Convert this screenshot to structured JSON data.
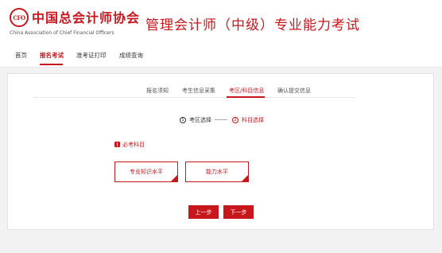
{
  "header": {
    "logo_emblem": "CFO",
    "logo_cn": "中国总会计师协会",
    "logo_en": "China Association of Chief Financial Officers",
    "site_title": "管理会计师（中级）专业能力考试"
  },
  "nav": {
    "items": [
      {
        "label": "首页"
      },
      {
        "label": "报名考试"
      },
      {
        "label": "准考证打印"
      },
      {
        "label": "成绩查询"
      }
    ],
    "active_index": 1
  },
  "steps": {
    "items": [
      {
        "label": "报名须知"
      },
      {
        "label": "考生信息采集"
      },
      {
        "label": "考区/科目信息"
      },
      {
        "label": "确认提交信息"
      }
    ],
    "active_index": 2
  },
  "substeps": [
    {
      "num": "1",
      "label": "考区选择"
    },
    {
      "num": "2",
      "label": "科目选择"
    }
  ],
  "section": {
    "label": "必考科目",
    "icon": "book-icon"
  },
  "subjects": [
    {
      "label": "专业知识水平"
    },
    {
      "label": "能力水平"
    }
  ],
  "buttons": {
    "prev": "上一步",
    "next": "下一步"
  },
  "colors": {
    "accent": "#c8161d",
    "background": "#f2f2f2"
  }
}
